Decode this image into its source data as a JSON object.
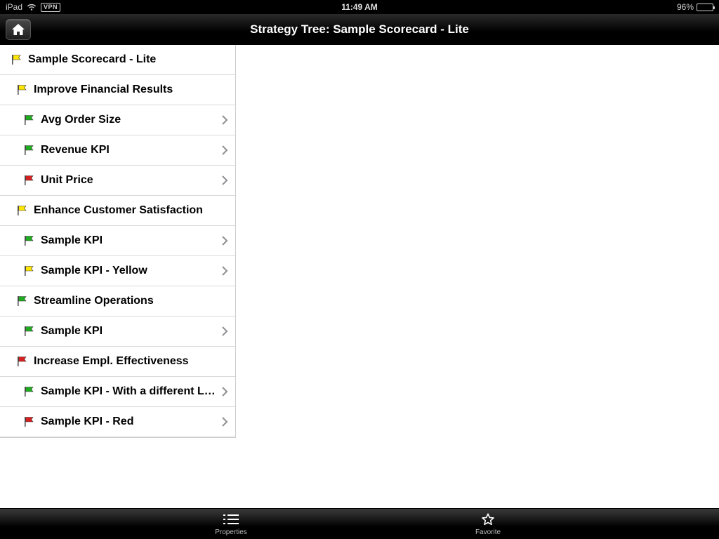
{
  "statusbar": {
    "device": "iPad",
    "vpn": "VPN",
    "time": "11:49 AM",
    "battery_pct": "96%"
  },
  "navbar": {
    "title": "Strategy Tree: Sample Scorecard - Lite"
  },
  "flag_colors": {
    "yellow": "#ffe600",
    "green": "#1fad1f",
    "red": "#d81f1f"
  },
  "tree": [
    {
      "label": "Sample Scorecard - Lite",
      "indent": 0,
      "flag": "yellow",
      "chevron": false
    },
    {
      "label": "Improve Financial Results",
      "indent": 1,
      "flag": "yellow",
      "chevron": false
    },
    {
      "label": "Avg Order Size",
      "indent": 2,
      "flag": "green",
      "chevron": true
    },
    {
      "label": "Revenue KPI",
      "indent": 2,
      "flag": "green",
      "chevron": true
    },
    {
      "label": "Unit Price",
      "indent": 2,
      "flag": "red",
      "chevron": true
    },
    {
      "label": "Enhance Customer Satisfaction",
      "indent": 1,
      "flag": "yellow",
      "chevron": false
    },
    {
      "label": "Sample KPI",
      "indent": 2,
      "flag": "green",
      "chevron": true
    },
    {
      "label": "Sample KPI - Yellow",
      "indent": 2,
      "flag": "yellow",
      "chevron": true
    },
    {
      "label": "Streamline Operations",
      "indent": 1,
      "flag": "green",
      "chevron": false
    },
    {
      "label": "Sample KPI",
      "indent": 2,
      "flag": "green",
      "chevron": true
    },
    {
      "label": "Increase Empl. Effectiveness",
      "indent": 1,
      "flag": "red",
      "chevron": false
    },
    {
      "label": "Sample KPI - With a different L…",
      "indent": 2,
      "flag": "green",
      "chevron": true
    },
    {
      "label": "Sample KPI - Red",
      "indent": 2,
      "flag": "red",
      "chevron": true
    }
  ],
  "tabbar": {
    "properties": "Properties",
    "favorite": "Favorite"
  }
}
